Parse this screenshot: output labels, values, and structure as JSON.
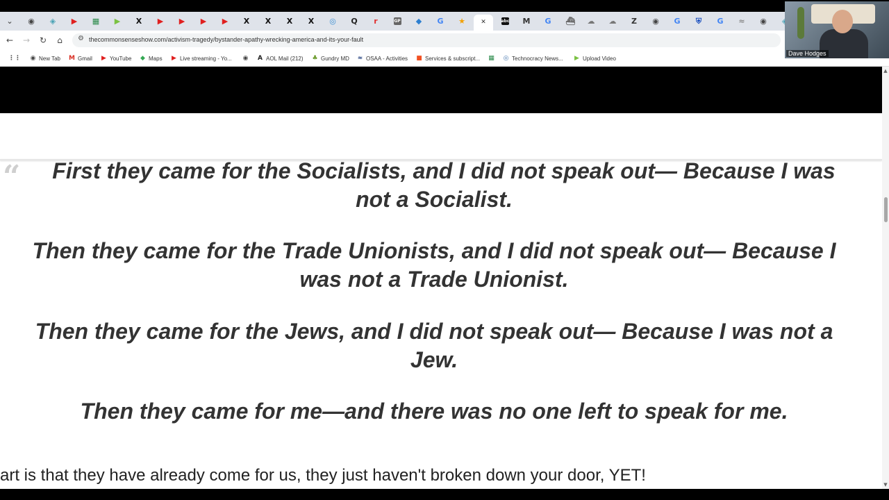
{
  "browser": {
    "tabs": [
      {
        "icon": "chevron-down-icon",
        "color": "#555555",
        "glyph": "⌄"
      },
      {
        "icon": "globe-icon",
        "color": "#444444",
        "glyph": "◉"
      },
      {
        "icon": "diamond-icon",
        "color": "#4aa3b5",
        "glyph": "◈"
      },
      {
        "icon": "youtube-icon",
        "color": "#e02020",
        "glyph": "▶"
      },
      {
        "icon": "sheet-icon",
        "color": "#2a8a4a",
        "glyph": "▦"
      },
      {
        "icon": "rumble-icon",
        "color": "#7ac142",
        "glyph": "▶"
      },
      {
        "icon": "x-icon",
        "color": "#111111",
        "glyph": "X"
      },
      {
        "icon": "youtube-icon",
        "color": "#e02020",
        "glyph": "▶"
      },
      {
        "icon": "youtube-icon",
        "color": "#e02020",
        "glyph": "▶"
      },
      {
        "icon": "youtube-icon",
        "color": "#e02020",
        "glyph": "▶"
      },
      {
        "icon": "youtube-icon",
        "color": "#e02020",
        "glyph": "▶"
      },
      {
        "icon": "x-icon",
        "color": "#111111",
        "glyph": "X"
      },
      {
        "icon": "x-icon",
        "color": "#111111",
        "glyph": "X"
      },
      {
        "icon": "x-icon",
        "color": "#111111",
        "glyph": "X"
      },
      {
        "icon": "x-icon",
        "color": "#111111",
        "glyph": "X"
      },
      {
        "icon": "swirl-icon",
        "color": "#3b8fd4",
        "glyph": "◎"
      },
      {
        "icon": "q-icon",
        "color": "#222222",
        "glyph": "Q"
      },
      {
        "icon": "r-icon",
        "color": "#e03030",
        "glyph": "r"
      },
      {
        "icon": "gp-icon",
        "color": "#666666",
        "glyph": "GP"
      },
      {
        "icon": "drop-icon",
        "color": "#2d7fd0",
        "glyph": "◆"
      },
      {
        "icon": "google-icon",
        "color": "#4285f4",
        "glyph": "G"
      },
      {
        "icon": "star-icon",
        "color": "#f2a000",
        "glyph": "★"
      },
      {
        "icon": "close-icon",
        "color": "#333333",
        "glyph": "✕",
        "active": true
      },
      {
        "icon": "abc-icon",
        "color": "#111111",
        "glyph": "abc"
      },
      {
        "icon": "m-icon",
        "color": "#333333",
        "glyph": "M"
      },
      {
        "icon": "google-icon",
        "color": "#4285f4",
        "glyph": "G"
      },
      {
        "icon": "ship-icon",
        "color": "#666666",
        "glyph": "⛴"
      },
      {
        "icon": "cloud-icon",
        "color": "#777777",
        "glyph": "☁"
      },
      {
        "icon": "cloud-icon",
        "color": "#777777",
        "glyph": "☁"
      },
      {
        "icon": "z-icon",
        "color": "#333333",
        "glyph": "Z"
      },
      {
        "icon": "globe-icon",
        "color": "#444444",
        "glyph": "◉"
      },
      {
        "icon": "google-icon",
        "color": "#4285f4",
        "glyph": "G"
      },
      {
        "icon": "shield-icon",
        "color": "#1a4fbf",
        "glyph": "⛨"
      },
      {
        "icon": "google-icon",
        "color": "#4285f4",
        "glyph": "G"
      },
      {
        "icon": "cat-icon",
        "color": "#888888",
        "glyph": "≈"
      },
      {
        "icon": "globe-icon",
        "color": "#444444",
        "glyph": "◉"
      },
      {
        "icon": "diamond-icon",
        "color": "#4aa3b5",
        "glyph": "◈"
      }
    ],
    "url": "thecommonsenseshow.com/activism-tragedy/bystander-apathy-wrecking-america-and-its-your-fault",
    "bookmarks": [
      {
        "label": "",
        "icon": "apps-grid-icon",
        "color": "#555555",
        "glyph": "⋮⋮"
      },
      {
        "label": "New Tab",
        "icon": "globe-icon",
        "color": "#444444",
        "glyph": "◉"
      },
      {
        "label": "Gmail",
        "icon": "gmail-icon",
        "color": "#d93025",
        "glyph": "M"
      },
      {
        "label": "YouTube",
        "icon": "youtube-icon",
        "color": "#e02020",
        "glyph": "▶"
      },
      {
        "label": "Maps",
        "icon": "maps-pin-icon",
        "color": "#34a853",
        "glyph": "◆"
      },
      {
        "label": "Live streaming - Yo...",
        "icon": "youtube-icon",
        "color": "#e02020",
        "glyph": "▶"
      },
      {
        "label": "",
        "icon": "globe-icon",
        "color": "#444444",
        "glyph": "◉"
      },
      {
        "label": "AOL Mail (212)",
        "icon": "aol-icon",
        "color": "#222222",
        "glyph": "A"
      },
      {
        "label": "Gundry MD",
        "icon": "leaf-icon",
        "color": "#6a9a2a",
        "glyph": "♣"
      },
      {
        "label": "OSAA - Activities",
        "icon": "osaa-icon",
        "color": "#1b3a7a",
        "glyph": "≈"
      },
      {
        "label": "Services & subscript...",
        "icon": "microsoft-icon",
        "color": "#f25022",
        "glyph": "■"
      },
      {
        "label": "",
        "icon": "sheet-icon",
        "color": "#2a8a4a",
        "glyph": "▦"
      },
      {
        "label": "Technocracy News...",
        "icon": "technocracy-icon",
        "color": "#4a7ab0",
        "glyph": "◎"
      },
      {
        "label": "Upload Video",
        "icon": "rumble-icon",
        "color": "#7ac142",
        "glyph": "▶"
      }
    ]
  },
  "article": {
    "verses": [
      {
        "line1": "First they came for the Socialists, and I did not speak out— Because I was",
        "line2": "not a Socialist."
      },
      {
        "line1": "Then they came for the Trade Unionists, and I did not speak out— Because I",
        "line2": "was not a Trade Unionist."
      },
      {
        "line1": "Then they came for the Jews, and I did not speak out— Because I was not a",
        "line2": "Jew."
      },
      {
        "line1": "Then they came for me—and there was no one left to speak for me.",
        "line2": ""
      }
    ],
    "body_line": "art is that they have already come for us, they just haven't broken down your door, YET!"
  },
  "webcam": {
    "name": "Dave Hodges"
  }
}
